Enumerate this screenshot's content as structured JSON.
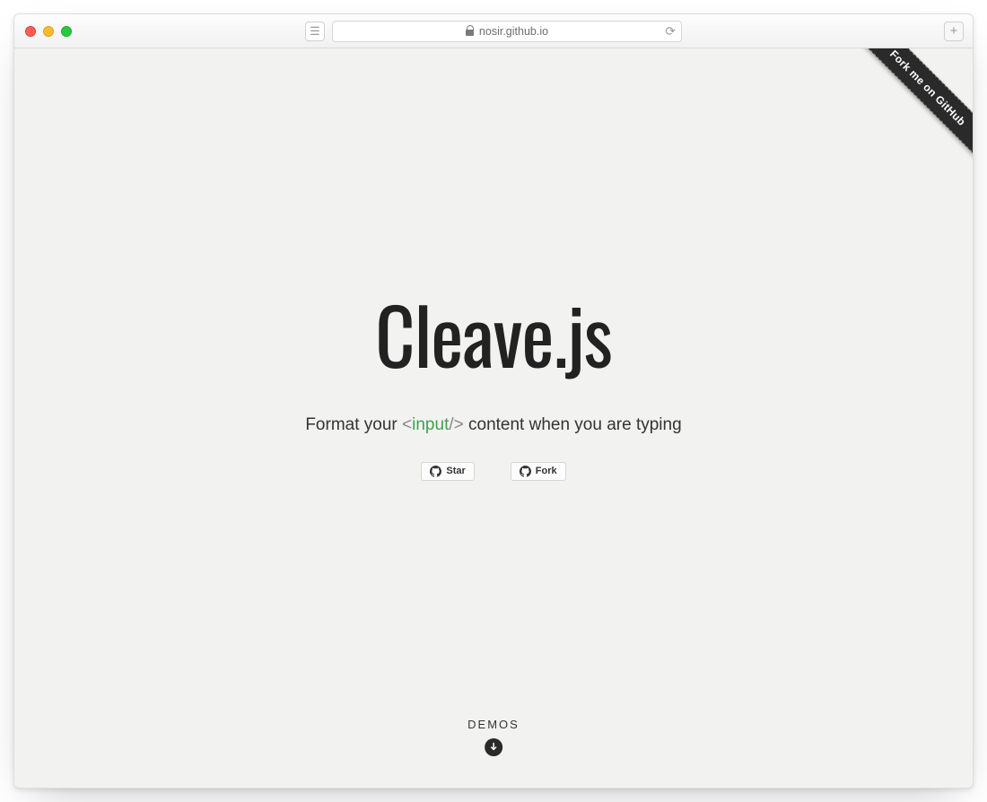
{
  "browser": {
    "url_host": "nosir.github.io",
    "reload_glyph": "⟳",
    "sidebar_glyph": "☰",
    "newtab_glyph": "+"
  },
  "ribbon": {
    "label": "Fork me on GitHub"
  },
  "hero": {
    "title": "Cleave.js",
    "subtitle_before": "Format your ",
    "subtitle_code_open": "<",
    "subtitle_code_inner": "input",
    "subtitle_code_close": "/>",
    "subtitle_after": " content when you are typing"
  },
  "github_buttons": {
    "star_label": "Star",
    "fork_label": "Fork"
  },
  "demos": {
    "label": "DEMOS"
  }
}
